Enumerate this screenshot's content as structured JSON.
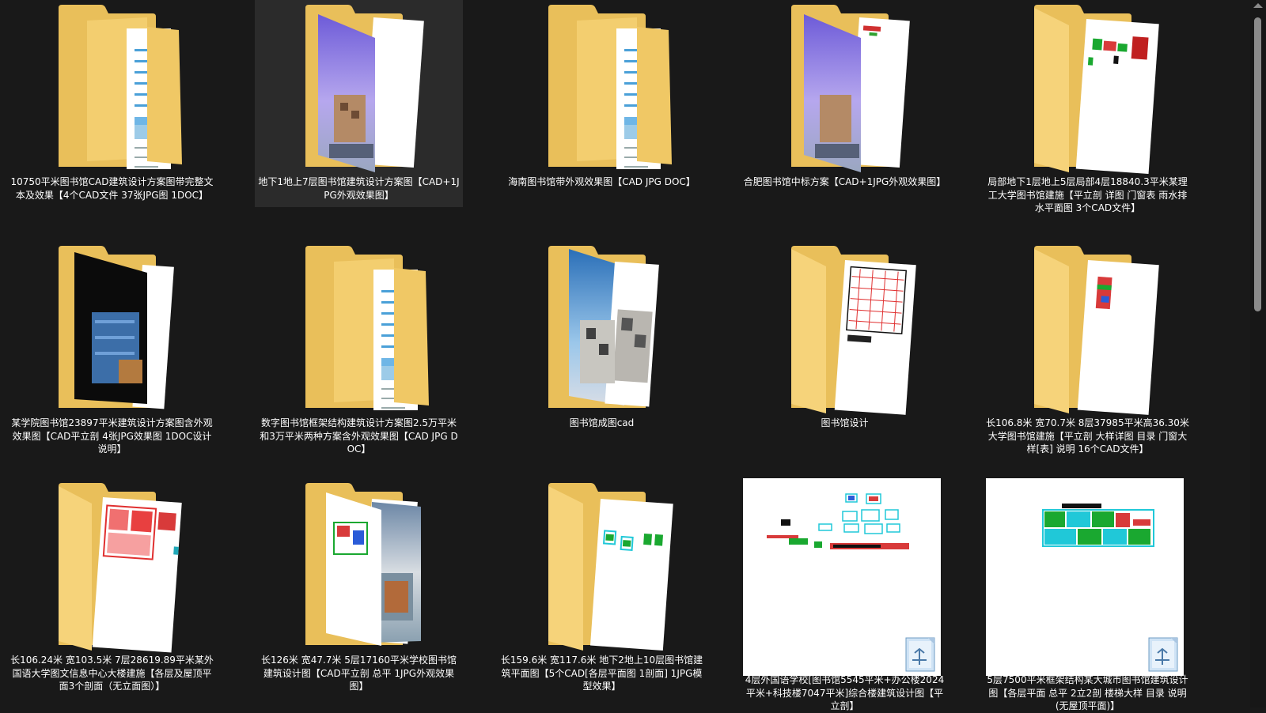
{
  "items": [
    {
      "label": "10750平米图书馆CAD建筑设计方案图带完整文本及效果【4个CAD文件 37张JPG图 1DOC】",
      "thumb": "folder-doc"
    },
    {
      "label": "地下1地上7层图书馆建筑设计方案图【CAD+1JPG外观效果图】",
      "thumb": "folder-photo-purple",
      "selected": true
    },
    {
      "label": "海南图书馆带外观效果图【CAD JPG DOC】",
      "thumb": "folder-doc"
    },
    {
      "label": "合肥图书馆中标方案【CAD+1JPG外观效果图】",
      "thumb": "folder-photo-cad"
    },
    {
      "label": "局部地下1层地上5层局部4层18840.3平米某理工大学图书馆建施【平立剖 详图 门窗表 雨水排水平面图 3个CAD文件】",
      "thumb": "folder-cad-colors"
    },
    {
      "label": "某学院图书馆23897平米建筑设计方案图含外观效果图【CAD平立剖 4张JPG效果图 1DOC设计说明】",
      "thumb": "folder-photo-dark"
    },
    {
      "label": "数字图书馆框架结构建筑设计方案图2.5万平米和3万平米两种方案含外观效果图【CAD JPG DOC】",
      "thumb": "folder-doc"
    },
    {
      "label": "图书馆成图cad",
      "thumb": "folder-photo-building"
    },
    {
      "label": "图书馆设计",
      "thumb": "folder-cad-red"
    },
    {
      "label": "长106.8米 宽70.7米 8层37985平米高36.30米大学图书馆建施【平立剖 大样详图 目录 门窗大样[表] 说明 16个CAD文件】",
      "thumb": "folder-cad-small"
    },
    {
      "label": "长106.24米 宽103.5米 7层28619.89平米某外国语大学图文信息中心大楼建施【各层及屋顶平面3个剖面（无立面图）】",
      "thumb": "folder-cad-red-plan"
    },
    {
      "label": "长126米 宽47.7米 5层17160平米学校图书馆建筑设计图【CAD平立剖 总平 1JPG外观效果图】",
      "thumb": "folder-cad-photo"
    },
    {
      "label": "长159.6米 宽117.6米 地下2地上10层图书馆建筑平面图【5个CAD[各层平面图 1剖面] 1JPG模型效果】",
      "thumb": "folder-cad-cyan"
    },
    {
      "label": "4层外国语学校[图书馆5545平米+办公楼2024平米+科技楼7047平米]综合楼建筑设计图【平立剖】",
      "thumb": "dwg-thumb-1"
    },
    {
      "label": "5层7500平米框架结构某大城市图书馆建筑设计图【各层平面 总平 2立2剖 楼梯大样 目录 说明(无屋顶平面)】",
      "thumb": "dwg-thumb-2"
    }
  ]
}
